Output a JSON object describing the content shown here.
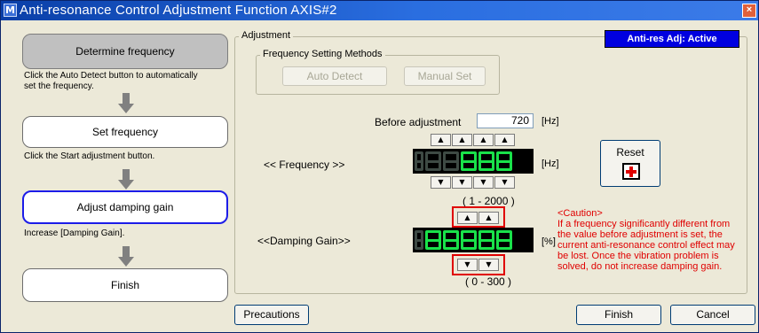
{
  "window": {
    "title": "Anti-resonance Control Adjustment Function AXIS#2",
    "icon_char": "M",
    "close_char": "×"
  },
  "steps": [
    {
      "label": "Determine frequency",
      "description": "Click the Auto Detect button to automatically set the frequency."
    },
    {
      "label": "Set frequency",
      "description": "Click the Start adjustment button."
    },
    {
      "label": "Adjust damping gain",
      "description": "Increase [Damping Gain]."
    },
    {
      "label": "Finish",
      "description": ""
    }
  ],
  "adjustment": {
    "group_label": "Adjustment",
    "status_badge": "Anti-res Adj: Active",
    "methods": {
      "group_label": "Frequency Setting Methods",
      "auto_detect": "Auto Detect",
      "manual_set": "Manual Set"
    },
    "before_adjustment_label": "Before adjustment",
    "before_adjustment_value": "720",
    "before_unit": "[Hz]",
    "frequency": {
      "label": "<< Frequency >>",
      "unit": "[Hz]",
      "range": "( 1 - 2000 )",
      "up_symbol": "▲",
      "down_symbol": "▼"
    },
    "damping": {
      "label": "<<Damping Gain>>",
      "unit": "[%]",
      "range": "( 0 - 300 )"
    },
    "reset_label": "Reset",
    "caution_title": "<Caution>",
    "caution_text": "If a frequency significantly different from the value before adjustment is set, the current anti-resonance control effect may be lost. Once the vibration problem is solved, do not increase damping gain."
  },
  "footer": {
    "precautions": "Precautions",
    "finish": "Finish",
    "cancel": "Cancel"
  },
  "colors": {
    "title_bar": "#0a3fa8",
    "status_badge": "#0000e0",
    "segment_on": "#19e24a",
    "caution": "#e00000",
    "active_step_border": "#1c1ce8"
  }
}
